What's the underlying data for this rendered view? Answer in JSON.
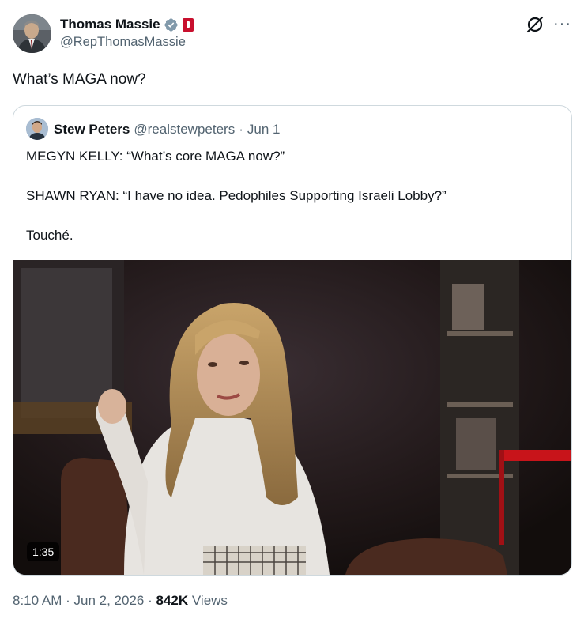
{
  "tweet": {
    "author_name": "Thomas Massie",
    "author_handle": "@RepThomasMassie",
    "text": "What’s MAGA now?",
    "more_glyph": "···",
    "icons": {
      "verified": "verified-badge-icon",
      "affiliation": "capitol-affiliation-icon",
      "grok": "grok-icon",
      "more": "more-options-icon"
    },
    "colors": {
      "verified": "#829aab",
      "affiliation": "#c8102e",
      "text": "#0f1419",
      "secondary": "#536471"
    }
  },
  "quote": {
    "author_name": "Stew Peters",
    "author_handle": "@realstewpeters",
    "separator": "·",
    "date": "Jun 1",
    "lines": [
      "MEGYN KELLY: “What’s core MAGA now?”",
      "SHAWN RYAN: “I have no idea. Pedophiles Supporting Israeli Lobby?”",
      "Touché."
    ],
    "video": {
      "duration": "1:35"
    }
  },
  "footer": {
    "time": "8:10 AM",
    "separator": "·",
    "date": "Jun 2, 2026",
    "views_count": "842K",
    "views_label": "Views"
  }
}
